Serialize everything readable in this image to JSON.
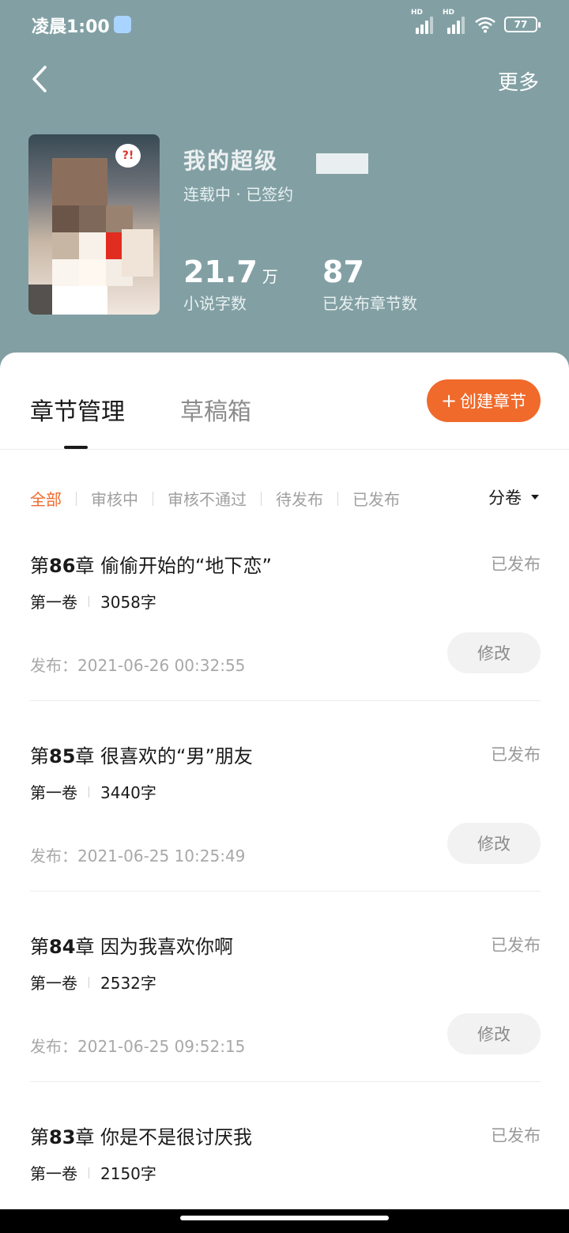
{
  "status_bar": {
    "time": "凌晨1:00",
    "battery": "77",
    "signal_label_1": "HD",
    "signal_label_2": "HD"
  },
  "nav": {
    "more": "更多"
  },
  "book": {
    "title": "我的超级",
    "status": "连载中 · 已签约",
    "cover_badge": "?!",
    "word_count": "21.7",
    "word_count_unit": "万",
    "word_count_label": "小说字数",
    "chapters_published": "87",
    "chapters_published_label": "已发布章节数"
  },
  "tabs": {
    "active": "章节管理",
    "inactive": "草稿箱",
    "create": "创建章节",
    "create_plus": "+"
  },
  "filters": [
    "全部",
    "审核中",
    "审核不通过",
    "待发布",
    "已发布"
  ],
  "volume_selector": "分卷",
  "chapters": [
    {
      "num_prefix": "第",
      "num": "86",
      "num_suffix": "章",
      "title": "偷偷开始的“地下恋”",
      "status": "已发布",
      "volume": "第一卷",
      "words": "3058字",
      "date": "发布：2021-06-26 00:32:55",
      "edit": "修改"
    },
    {
      "num_prefix": "第",
      "num": "85",
      "num_suffix": "章",
      "title": "很喜欢的“男”朋友",
      "status": "已发布",
      "volume": "第一卷",
      "words": "3440字",
      "date": "发布：2021-06-25 10:25:49",
      "edit": "修改"
    },
    {
      "num_prefix": "第",
      "num": "84",
      "num_suffix": "章",
      "title": "因为我喜欢你啊",
      "status": "已发布",
      "volume": "第一卷",
      "words": "2532字",
      "date": "发布：2021-06-25 09:52:15",
      "edit": "修改"
    },
    {
      "num_prefix": "第",
      "num": "83",
      "num_suffix": "章",
      "title": "你是不是很讨厌我",
      "status": "已发布",
      "volume": "第一卷",
      "words": "2150字",
      "date": "",
      "edit": ""
    }
  ]
}
